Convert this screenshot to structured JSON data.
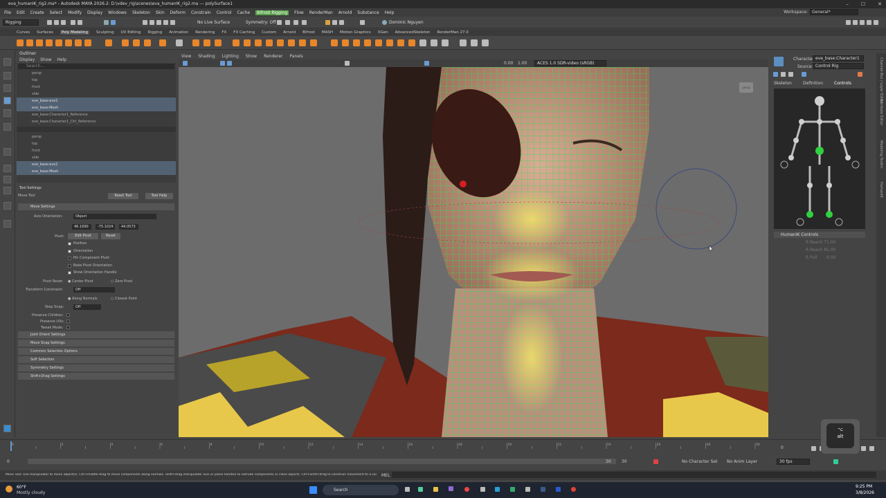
{
  "window": {
    "title": "eva_humanIK_rig2.ma* - Autodesk MAYA 2026.2: D:\\vdev_rig\\scenes\\eva_humanIK_rig2.ma --- polySurface1",
    "minimize": "–",
    "maximize": "☐",
    "close": "✕"
  },
  "menubar": {
    "items": [
      "File",
      "Edit",
      "Create",
      "Select",
      "Modify",
      "Display",
      "Windows",
      "Skeleton",
      "Skin",
      "Deform",
      "Constrain",
      "Control",
      "Cache",
      "Bifrost Rigging",
      "Flow",
      "RenderMan",
      "Arnold",
      "Substance",
      "Help"
    ],
    "highlighted": "Bifrost Rigging",
    "workspace_label": "Workspace:",
    "workspace_value": "General*"
  },
  "statusline": {
    "menuset": "Rigging",
    "live_surface": "No Live Surface",
    "symmetry": "Symmetry: Off",
    "user": "Dominic Nguyen"
  },
  "shelf_tabs": {
    "items": [
      "Curves",
      "Surfaces",
      "Poly Modeling",
      "Sculpting",
      "UV Editing",
      "Rigging",
      "Animation",
      "Rendering",
      "FX",
      "FX Caching",
      "Custom",
      "Arnold",
      "Bifrost",
      "MASH",
      "Motion Graphics",
      "XGen",
      "AdvancedSkeleton",
      "RenderMan 27.0"
    ],
    "active": "Poly Modeling"
  },
  "outliner": {
    "title": "Outliner",
    "menus": [
      "Display",
      "Show",
      "Help"
    ],
    "search_placeholder": "Search...",
    "top_rows": [
      {
        "label": "persp",
        "selected": false
      },
      {
        "label": "top",
        "selected": false
      },
      {
        "label": "front",
        "selected": false
      },
      {
        "label": "side",
        "selected": false
      },
      {
        "label": "eve_base:eve1",
        "selected": true
      },
      {
        "label": "eve_base:Mesh",
        "selected": true
      },
      {
        "label": "eve_base:Character1_Reference",
        "selected": false
      },
      {
        "label": "eve_base:Character1_Ctrl_Reference",
        "selected": false
      }
    ],
    "bottom_rows": [
      {
        "label": "persp",
        "selected": false
      },
      {
        "label": "top",
        "selected": false
      },
      {
        "label": "front",
        "selected": false
      },
      {
        "label": "side",
        "selected": false
      },
      {
        "label": "eve_base:eve1",
        "selected": true
      },
      {
        "label": "eve_base:Mesh",
        "selected": true
      }
    ]
  },
  "tool_settings": {
    "title": "Tool Settings",
    "tool_name": "Move Tool",
    "reset_tool": "Reset Tool",
    "tool_help": "Tool Help",
    "move_settings": "Move Settings",
    "axis_orientation_label": "Axis Orientation:",
    "axis_orientation_value": "Object",
    "xyz": [
      "46.1690",
      "-75.1024",
      "44.0573"
    ],
    "pivot_label": "Pivot:",
    "edit_pivot": "Edit Pivot",
    "reset": "Reset",
    "checks": [
      {
        "label": "Position",
        "checked": true
      },
      {
        "label": "Orientation",
        "checked": true
      },
      {
        "label": "Pin Component Pivot",
        "checked": false
      },
      {
        "label": "Bake Pivot Orientation",
        "checked": false
      },
      {
        "label": "Show Orientation Handle",
        "checked": true
      }
    ],
    "pivot_reset_label": "Pivot Reset:",
    "center_pivot": "Center Pivot",
    "zero_pivot": "Zero Pivot",
    "transform_constraint_label": "Transform Constraint:",
    "transform_constraint_value": "Off",
    "along_normals": "Along Normals",
    "closest_point": "Closest Point",
    "step_snap_label": "Step Snap:",
    "step_snap_value": "Off",
    "preserve_children": "Preserve Children:",
    "preserve_uvs": "Preserve UVs:",
    "tweak_mode": "Tweak Mode:",
    "sections": [
      "Joint Orient Settings",
      "Move Snap Settings",
      "Common Selection Options",
      "Soft Selection",
      "Symmetry Settings",
      "Shift+Drag Settings"
    ]
  },
  "viewport": {
    "menus": [
      "View",
      "Shading",
      "Lighting",
      "Show",
      "Renderer",
      "Panels"
    ],
    "exposure": "0.00",
    "gamma": "1.00",
    "colorspace": "ACES 1.0 SDR-video (sRGB)",
    "cam_label": "persp"
  },
  "humanik": {
    "character_label": "Character:",
    "character_value": "eve_base:Character1",
    "source_label": "Source:",
    "source_value": "Control Rig",
    "tabs": [
      "Skeleton",
      "Definition",
      "Controls"
    ],
    "active_tab": "Controls",
    "controls_header": "HumanIK Controls",
    "sliders": [
      {
        "label": "R Reach T",
        "value": "1.00"
      },
      {
        "label": "R Reach R",
        "value": "1.00"
      },
      {
        "label": "R Pull",
        "value": "0.00"
      }
    ]
  },
  "side_strip": [
    "Channel Box / Layer Editor",
    "Attribute Editor",
    "Modeling Toolkit",
    "HumanIK"
  ],
  "timeline": {
    "ticks": [
      "0",
      "2",
      "4",
      "6",
      "8",
      "10",
      "12",
      "14",
      "16",
      "18",
      "20",
      "22",
      "24",
      "26",
      "28",
      "30"
    ],
    "current_frame": "0",
    "range_start": "0",
    "range_start2": "0",
    "range_end": "30",
    "range_end2": "30",
    "character_set": "No Character Set",
    "anim_layer": "No Anim Layer",
    "fps": "30 fps"
  },
  "help_line": {
    "text": "Move Tool: Use manipulator to move object(s). Ctrl+middle-drag to move components along normals. Shift+drag manipulator axis or plane handles to extrude components or clone objects. Ctrl+Shift+drag to constrain movement to a connected edge.",
    "mel": "MEL"
  },
  "taskbar": {
    "weather_temp": "60°F",
    "weather_desc": "Mostly cloudy",
    "search": "Search",
    "time": "9:25 PM",
    "date": "3/8/2026"
  },
  "keypress_overlay": {
    "symbol": "⌥",
    "key": "alt"
  },
  "colors": {
    "selection_highlight": "#536273",
    "bifrost_menu": "#5aa34a",
    "wireframe": "#33e050",
    "soft_select": "#e8d24a"
  }
}
